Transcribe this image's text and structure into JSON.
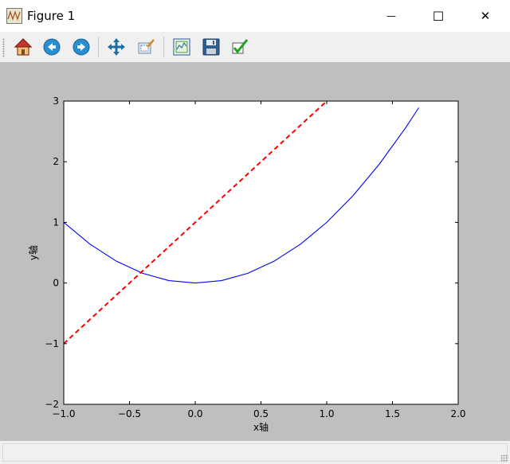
{
  "window": {
    "title": "Figure 1",
    "minimize_glyph": "—",
    "maximize_glyph": "☐",
    "close_glyph": "✕"
  },
  "toolbar": {
    "items": [
      {
        "name": "home-button",
        "icon": "home-icon"
      },
      {
        "name": "back-button",
        "icon": "back-arrow-icon"
      },
      {
        "name": "forward-button",
        "icon": "forward-arrow-icon"
      },
      {
        "name": "pan-button",
        "icon": "pan-move-icon"
      },
      {
        "name": "zoom-button",
        "icon": "zoom-rect-icon"
      },
      {
        "name": "subplots-button",
        "icon": "subplots-config-icon"
      },
      {
        "name": "save-button",
        "icon": "save-floppy-icon"
      },
      {
        "name": "edit-axes-button",
        "icon": "checkmark-icon"
      }
    ]
  },
  "chart_data": {
    "type": "line",
    "title": "",
    "xlabel": "x轴",
    "ylabel": "y轴",
    "xlim": [
      -1.0,
      2.0
    ],
    "ylim": [
      -2,
      3
    ],
    "xticks": [
      -1.0,
      -0.5,
      0.0,
      0.5,
      1.0,
      1.5,
      2.0
    ],
    "xtick_labels": [
      "−1.0",
      "−0.5",
      "0.0",
      "0.5",
      "1.0",
      "1.5",
      "2.0"
    ],
    "yticks": [
      -2,
      -1,
      0,
      1,
      2,
      3
    ],
    "ytick_labels": [
      "−2",
      "−1",
      "0",
      "1",
      "2",
      "3"
    ],
    "grid": false,
    "series": [
      {
        "color": "#0000ff",
        "style": "solid",
        "x": [
          -1.0,
          -0.8,
          -0.6,
          -0.4,
          -0.2,
          0.0,
          0.2,
          0.4,
          0.6,
          0.8,
          1.0,
          1.2,
          1.4,
          1.6,
          1.7
        ],
        "y": [
          1.0,
          0.64,
          0.36,
          0.16,
          0.04,
          0.0,
          0.04,
          0.16,
          0.36,
          0.64,
          1.0,
          1.44,
          1.96,
          2.56,
          2.89
        ]
      },
      {
        "color": "#ff0000",
        "style": "dashed",
        "x": [
          -1.0,
          1.0
        ],
        "y": [
          -1.0,
          3.0
        ]
      }
    ]
  },
  "colors": {
    "canvas_bg": "#bfbfbf",
    "plot_bg": "#ffffff"
  }
}
